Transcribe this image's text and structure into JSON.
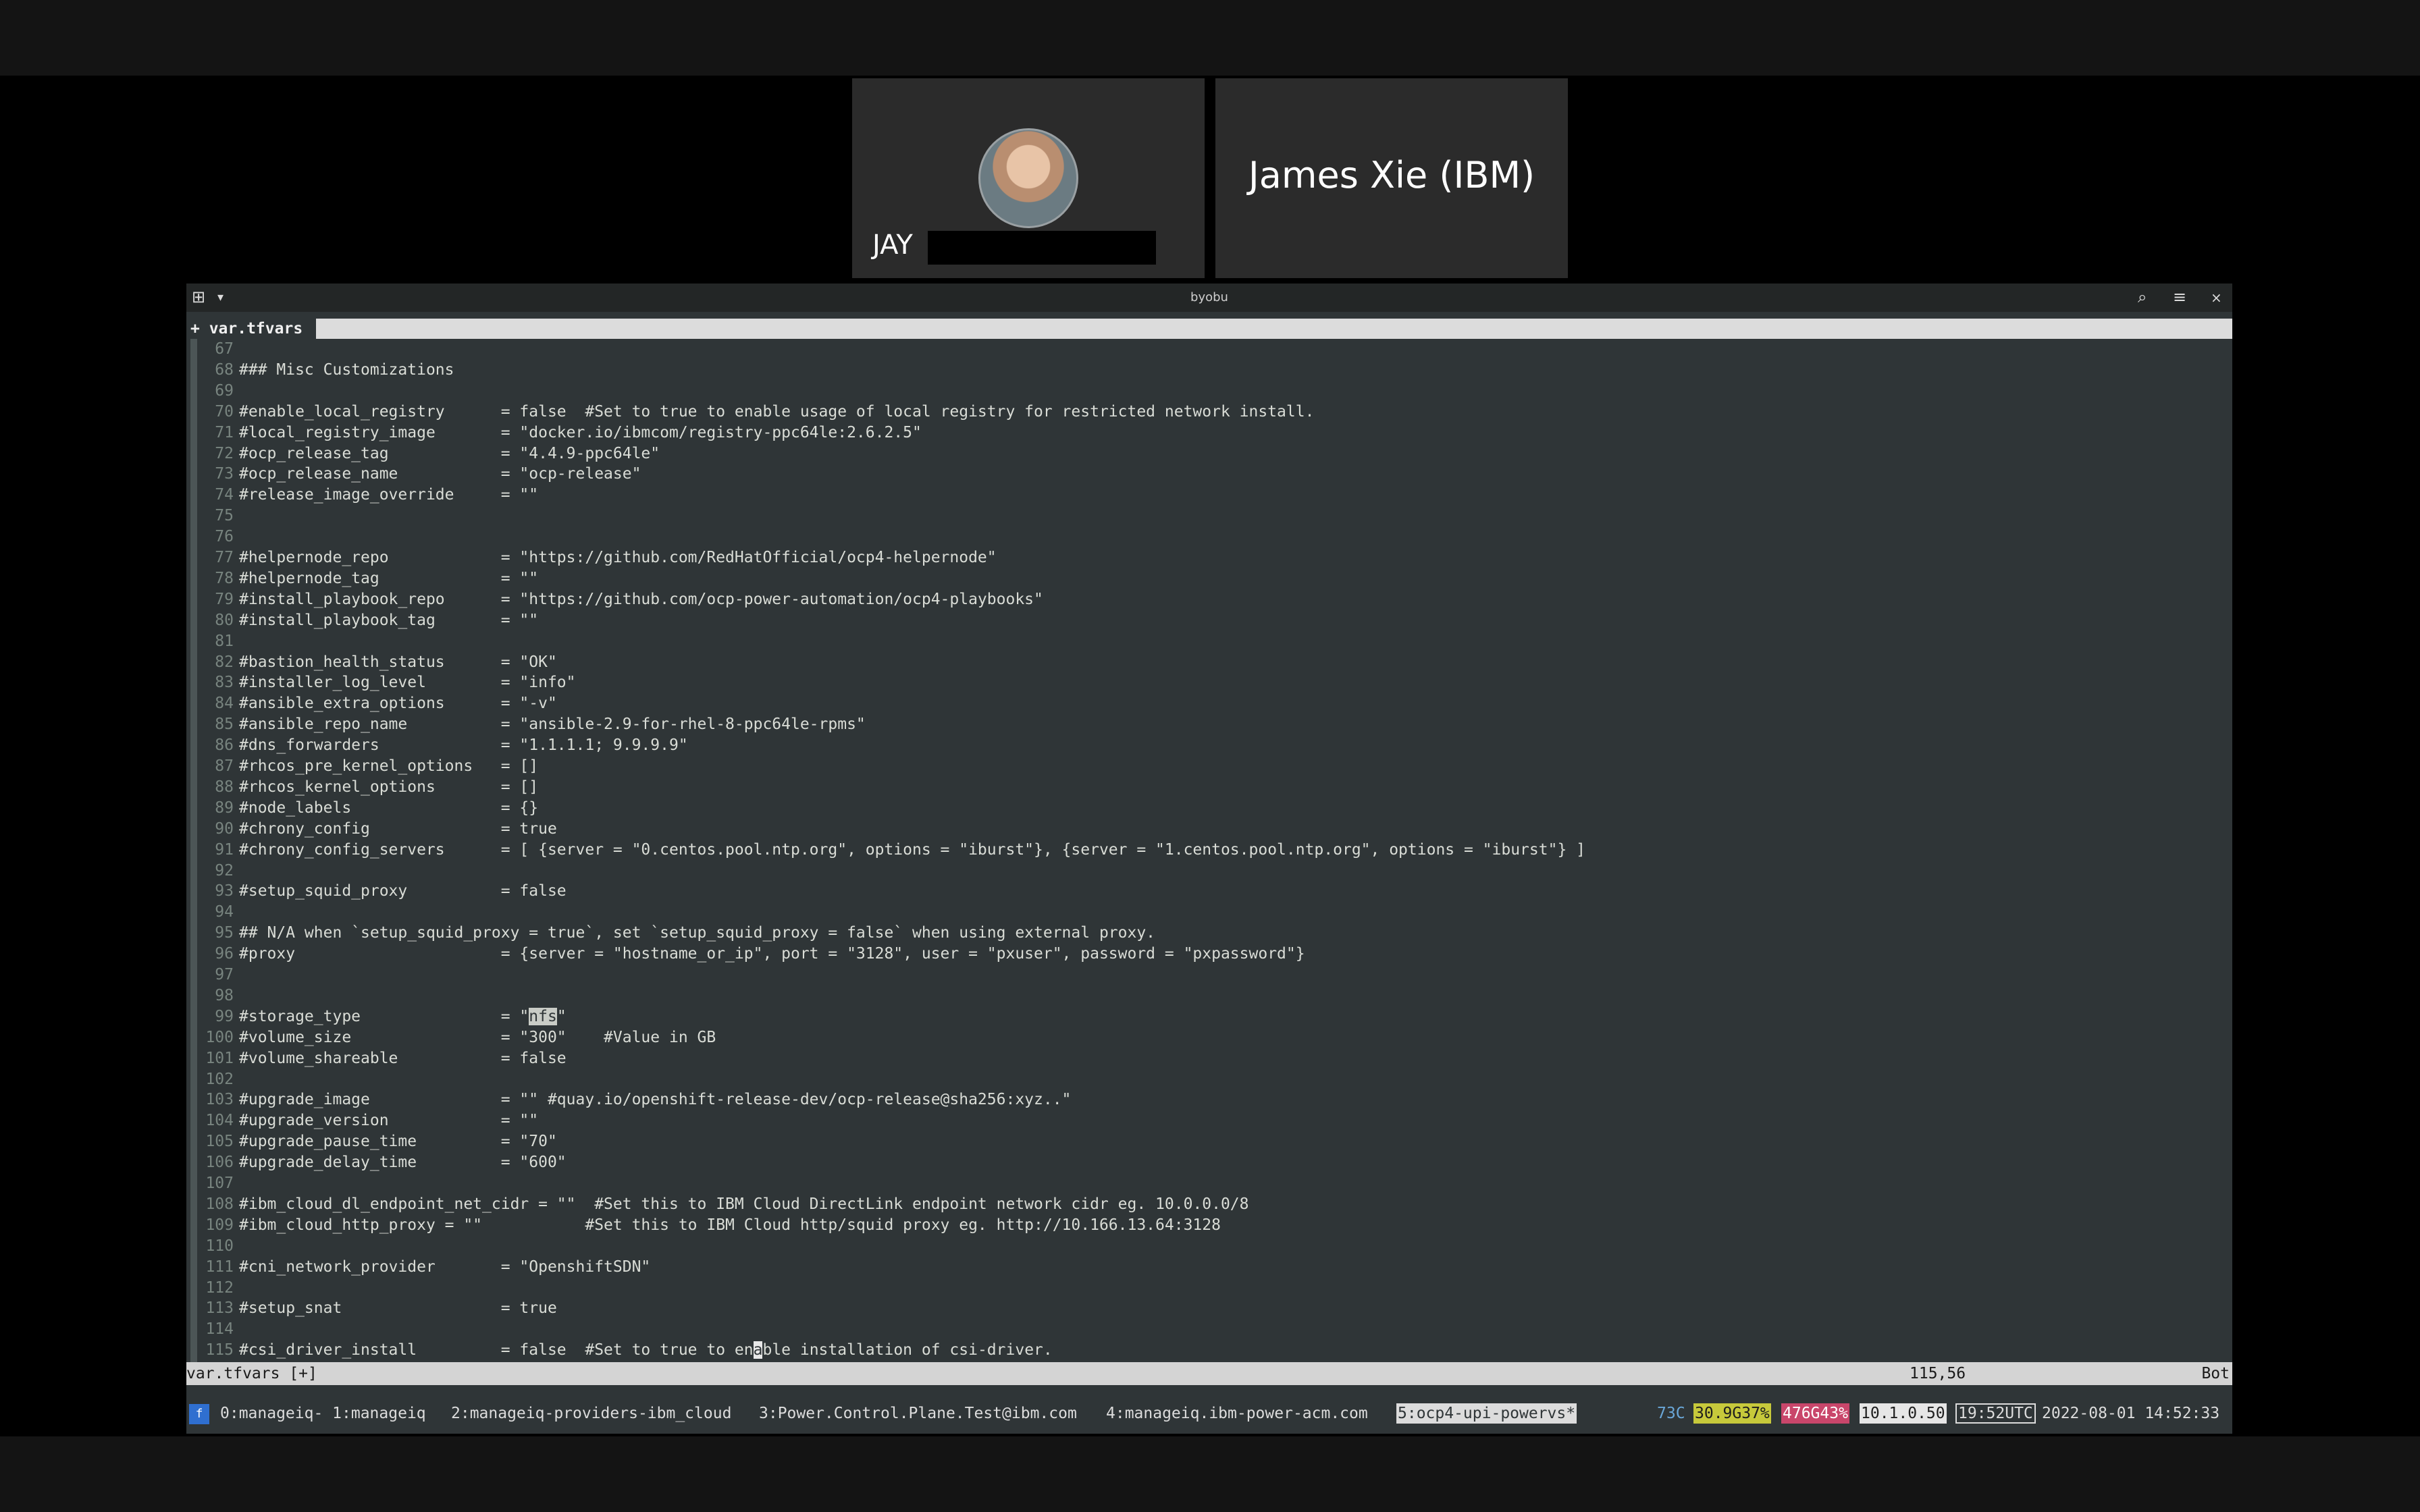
{
  "meeting": {
    "participant1": {
      "name": "JAY"
    },
    "participant2": {
      "name": "James Xie (IBM)"
    }
  },
  "terminal": {
    "title": "byobu",
    "tab": "+ var.tfvars",
    "icons": {
      "new_tab": "new-tab-icon",
      "dropdown": "chevron-down-icon",
      "search": "search-icon",
      "menu": "hamburger-icon",
      "close": "close-icon"
    }
  },
  "editor": {
    "lines": [
      {
        "n": "67",
        "t": ""
      },
      {
        "n": "68",
        "t": "### Misc Customizations"
      },
      {
        "n": "69",
        "t": ""
      },
      {
        "n": "70",
        "t": "#enable_local_registry      = false  #Set to true to enable usage of local registry for restricted network install."
      },
      {
        "n": "71",
        "t": "#local_registry_image       = \"docker.io/ibmcom/registry-ppc64le:2.6.2.5\""
      },
      {
        "n": "72",
        "t": "#ocp_release_tag            = \"4.4.9-ppc64le\""
      },
      {
        "n": "73",
        "t": "#ocp_release_name           = \"ocp-release\""
      },
      {
        "n": "74",
        "t": "#release_image_override     = \"\""
      },
      {
        "n": "75",
        "t": ""
      },
      {
        "n": "76",
        "t": ""
      },
      {
        "n": "77",
        "t": "#helpernode_repo            = \"https://github.com/RedHatOfficial/ocp4-helpernode\""
      },
      {
        "n": "78",
        "t": "#helpernode_tag             = \"\""
      },
      {
        "n": "79",
        "t": "#install_playbook_repo      = \"https://github.com/ocp-power-automation/ocp4-playbooks\""
      },
      {
        "n": "80",
        "t": "#install_playbook_tag       = \"\""
      },
      {
        "n": "81",
        "t": ""
      },
      {
        "n": "82",
        "t": "#bastion_health_status      = \"OK\""
      },
      {
        "n": "83",
        "t": "#installer_log_level        = \"info\""
      },
      {
        "n": "84",
        "t": "#ansible_extra_options      = \"-v\""
      },
      {
        "n": "85",
        "t": "#ansible_repo_name          = \"ansible-2.9-for-rhel-8-ppc64le-rpms\""
      },
      {
        "n": "86",
        "t": "#dns_forwarders             = \"1.1.1.1; 9.9.9.9\""
      },
      {
        "n": "87",
        "t": "#rhcos_pre_kernel_options   = []"
      },
      {
        "n": "88",
        "t": "#rhcos_kernel_options       = []"
      },
      {
        "n": "89",
        "t": "#node_labels                = {}"
      },
      {
        "n": "90",
        "t": "#chrony_config              = true"
      },
      {
        "n": "91",
        "t": "#chrony_config_servers      = [ {server = \"0.centos.pool.ntp.org\", options = \"iburst\"}, {server = \"1.centos.pool.ntp.org\", options = \"iburst\"} ]"
      },
      {
        "n": "92",
        "t": ""
      },
      {
        "n": "93",
        "t": "#setup_squid_proxy          = false"
      },
      {
        "n": "94",
        "t": ""
      },
      {
        "n": "95",
        "t": "## N/A when `setup_squid_proxy = true`, set `setup_squid_proxy = false` when using external proxy."
      },
      {
        "n": "96",
        "t": "#proxy                      = {server = \"hostname_or_ip\", port = \"3128\", user = \"pxuser\", password = \"pxpassword\"}"
      },
      {
        "n": "97",
        "t": ""
      },
      {
        "n": "98",
        "t": ""
      },
      {
        "n": "99",
        "t": "#storage_type               = \"",
        "sel": "nfs",
        "after": "\""
      },
      {
        "n": "100",
        "t": "#volume_size                = \"300\"    #Value in GB"
      },
      {
        "n": "101",
        "t": "#volume_shareable           = false"
      },
      {
        "n": "102",
        "t": ""
      },
      {
        "n": "103",
        "t": "#upgrade_image              = \"\" #quay.io/openshift-release-dev/ocp-release@sha256:xyz..\""
      },
      {
        "n": "104",
        "t": "#upgrade_version            = \"\""
      },
      {
        "n": "105",
        "t": "#upgrade_pause_time         = \"70\""
      },
      {
        "n": "106",
        "t": "#upgrade_delay_time         = \"600\""
      },
      {
        "n": "107",
        "t": ""
      },
      {
        "n": "108",
        "t": "#ibm_cloud_dl_endpoint_net_cidr = \"\"  #Set this to IBM Cloud DirectLink endpoint network cidr eg. 10.0.0.0/8"
      },
      {
        "n": "109",
        "t": "#ibm_cloud_http_proxy = \"\"           #Set this to IBM Cloud http/squid proxy eg. http://10.166.13.64:3128"
      },
      {
        "n": "110",
        "t": ""
      },
      {
        "n": "111",
        "t": "#cni_network_provider       = \"OpenshiftSDN\""
      },
      {
        "n": "112",
        "t": ""
      },
      {
        "n": "113",
        "t": "#setup_snat                 = true"
      },
      {
        "n": "114",
        "t": ""
      },
      {
        "n": "115",
        "t": "#csi_driver_install         = false  #Set to true to en",
        "cursor": "a",
        "after": "ble installation of csi-driver."
      }
    ]
  },
  "vim_status": {
    "file": "var.tfvars [+]",
    "position": "115,56",
    "scroll": "Bot"
  },
  "byobu_bar": {
    "windows": [
      "0:manageiq- 1:manageiq",
      "2:manageiq-providers-ibm_cloud",
      "3:Power.Control.Plane.Test@ibm.com",
      "4:manageiq.ibm-power-acm.com"
    ],
    "active_window": "5:ocp4-upi-powervs*",
    "temp": "73C",
    "cpu": "30.9G37%",
    "mem": "476G43%",
    "ip": "10.1.0.50",
    "utc": "19:52UTC",
    "datetime": "2022-08-01 14:52:33",
    "colors": {
      "cpu": "#c7c93b",
      "mem": "#c9466b",
      "logo": "#2f6fd0"
    }
  }
}
